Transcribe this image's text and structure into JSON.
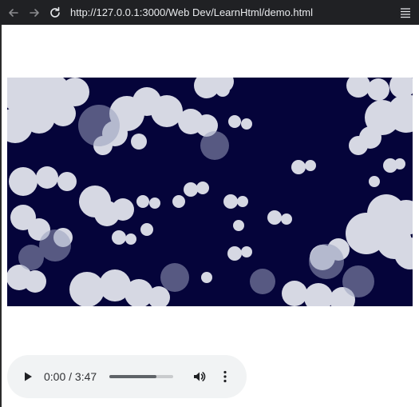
{
  "browser": {
    "url": "http://127.0.0.1:3000/Web Dev/LearnHtml/demo.html",
    "icons": {
      "back": "back-arrow-icon",
      "forward": "forward-arrow-icon",
      "reload": "reload-icon",
      "menu": "menu-icon"
    }
  },
  "video": {
    "content": "clouds-over-dark-navy-sky",
    "background_color": "#05043a"
  },
  "audio_player": {
    "time_display": "0:00 / 3:47",
    "progress_fraction": 0.73,
    "icons": {
      "play": "play-icon",
      "volume": "volume-icon",
      "more": "more-options-icon"
    }
  }
}
